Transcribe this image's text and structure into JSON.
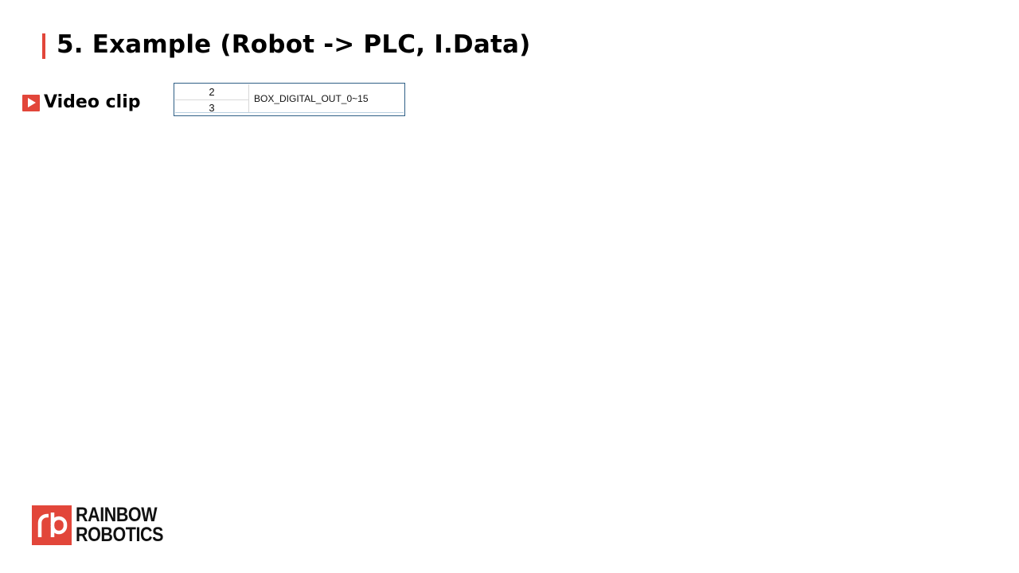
{
  "slide": {
    "title": "5. Example (Robot -> PLC, I.Data)",
    "accent_color": "#e2463a"
  },
  "video": {
    "icon": "play-icon",
    "label": "Video clip"
  },
  "register_table": {
    "rows": [
      "2",
      "3"
    ],
    "description": "BOX_DIGITAL_OUT_0~15",
    "border_color": "#2f5f86"
  },
  "logo": {
    "icon": "rb-logo-mark",
    "line1": "RAINBOW",
    "line2": "ROBOTICS"
  }
}
